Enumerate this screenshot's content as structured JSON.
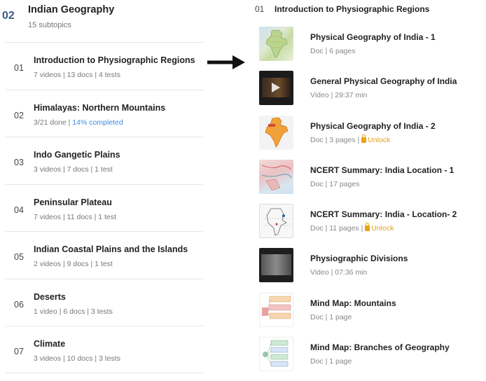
{
  "chapter": {
    "number": "02",
    "title": "Indian Geography",
    "subtitle": "15 subtopics"
  },
  "topics": [
    {
      "num": "01",
      "title": "Introduction to Physiographic Regions",
      "meta": "7 videos  | 13 docs | 4 tests"
    },
    {
      "num": "02",
      "title": "Himalayas: Northern Mountains",
      "meta": "3/21 done | ",
      "progress": "14% completed"
    },
    {
      "num": "03",
      "title": "Indo Gangetic Plains",
      "meta": "3 videos  | 7 docs | 1 test"
    },
    {
      "num": "04",
      "title": "Peninsular Plateau",
      "meta": "7 videos  | 11 docs | 1 test"
    },
    {
      "num": "05",
      "title": "Indian Coastal Plains and the Islands",
      "meta": "2 videos  | 9 docs | 1 test"
    },
    {
      "num": "06",
      "title": "Deserts",
      "meta": "1 video  | 6 docs | 3 tests"
    },
    {
      "num": "07",
      "title": "Climate",
      "meta": "3 videos  | 10 docs | 3 tests"
    }
  ],
  "selected": {
    "num": "01",
    "title": "Introduction to Physiographic Regions"
  },
  "items": [
    {
      "title": "Physical Geography of India - 1",
      "meta": "Doc | 6 pages",
      "unlock": "",
      "thumb": "map-thumbnail"
    },
    {
      "title": "General Physical Geography of India",
      "meta": "Video | 29:37 min",
      "unlock": "",
      "thumb": "video-thumbnail"
    },
    {
      "title": "Physical Geography of India - 2",
      "meta": "Doc | 3 pages | ",
      "unlock": "Unlock",
      "thumb": "india-map-thumbnail"
    },
    {
      "title": "NCERT Summary: India Location - 1",
      "meta": "Doc | 17 pages",
      "unlock": "",
      "thumb": "map-thumbnail"
    },
    {
      "title": "NCERT Summary: India - Location- 2",
      "meta": "Doc | 11 pages | ",
      "unlock": "Unlock",
      "thumb": "map-thumbnail"
    },
    {
      "title": "Physiographic Divisions",
      "meta": "Video | 07:36 min",
      "unlock": "",
      "thumb": "video-thumbnail"
    },
    {
      "title": "Mind Map: Mountains",
      "meta": "Doc | 1 page",
      "unlock": "",
      "thumb": "mind-map-thumbnail"
    },
    {
      "title": "Mind Map: Branches of Geography",
      "meta": "Doc | 1 page",
      "unlock": "",
      "thumb": "mind-map-thumbnail"
    }
  ],
  "colors": {
    "accent": "#3b5b8a",
    "progress": "#3d8be6",
    "unlock": "#e8a317"
  }
}
